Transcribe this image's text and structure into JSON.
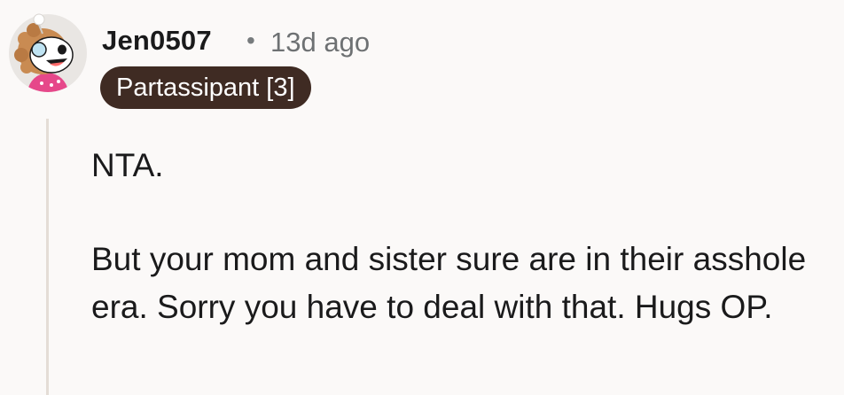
{
  "comment": {
    "username": "Jen0507",
    "separator": "•",
    "timestamp": "13d ago",
    "flair": "Partassipant [3]",
    "paragraphs": [
      "NTA.",
      "But your mom and sister sure are in their asshole era. Sorry you have to deal with that. Hugs OP."
    ]
  },
  "colors": {
    "background": "#fbf9f8",
    "flair_bg": "#3f2b23",
    "flair_text": "#ffffff",
    "thread_line": "#e4ddd6"
  }
}
